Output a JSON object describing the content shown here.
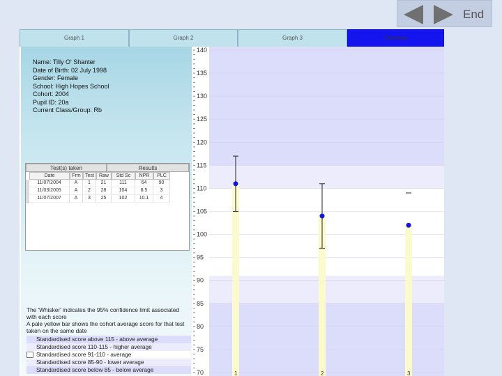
{
  "nav": {
    "back_icon": "left-arrow-icon",
    "forward_icon": "right-arrow-icon",
    "end_label": "End",
    "panel_color": "#c3cee2"
  },
  "tabs": [
    {
      "label": "Graph 1"
    },
    {
      "label": "Graph 2"
    },
    {
      "label": "Graph 3"
    },
    {
      "label": "Overview"
    }
  ],
  "pupil": {
    "name": "Name: Tilly O' Shanter",
    "dob": "Date of Birth: 02 July 1998",
    "gender": "Gender: Female",
    "school": "School: High Hopes School",
    "cohort": "Cohort: 2004",
    "pupil_id": "Pupil ID: 20a",
    "current_class": "Current Class/Group: Rb"
  },
  "tests_table": {
    "group_headers": [
      "Test(s) taken",
      "Results"
    ],
    "columns": [
      "Date",
      "Frm",
      "Test",
      "Raw",
      "Std Sc",
      "NPR",
      "PLC"
    ],
    "rows": [
      [
        "11/07/2004",
        "A",
        "1",
        "21",
        "111",
        "64",
        "90"
      ],
      [
        "11/03/2005",
        "A",
        "2",
        "28",
        "104",
        "8.5",
        "3"
      ],
      [
        "11/07/2007",
        "A",
        "3",
        "25",
        "102",
        "10.1",
        "4"
      ]
    ]
  },
  "legend": {
    "whisker_text": "The 'Whisker' indicates the 95% confidence limit associated with each score",
    "cohort_text": "A pale yellow bar shows the cohort average score for that test taken on the same date",
    "bands": [
      {
        "label": "Standardised score above 115 - above average",
        "color": "#dcdcfb"
      },
      {
        "label": "Standardised score 110-115 - higher average",
        "color": "#ececfc"
      },
      {
        "label": "Standardised score 91-110 - average",
        "color": "#ffffff"
      },
      {
        "label": "Standardised score 85-90 - lower average",
        "color": "#ececfc"
      },
      {
        "label": "Standardised score below 85 - below average",
        "color": "#dcdcfb"
      }
    ]
  },
  "chart_data": {
    "type": "scatter",
    "categories": [
      "1",
      "2",
      "3"
    ],
    "ylim": [
      70,
      140
    ],
    "y_ticks": [
      "140",
      "135",
      "130",
      "125",
      "120",
      "115",
      "110",
      "105",
      "100",
      "95",
      "90",
      "85",
      "80",
      "75",
      "70"
    ],
    "series": [
      {
        "values": [
          111,
          104,
          102
        ],
        "lower": [
          105,
          97,
          null
        ],
        "upper": [
          117,
          111,
          109
        ]
      }
    ],
    "point_color": "#1414e0",
    "bands": [
      {
        "from": 115,
        "to": 140,
        "color": "#dcdcfb"
      },
      {
        "from": 110,
        "to": 115,
        "color": "#ececfc"
      },
      {
        "from": 91,
        "to": 110,
        "color": "#ffffff"
      },
      {
        "from": 85,
        "to": 91,
        "color": "#ececfc"
      },
      {
        "from": 70,
        "to": 85,
        "color": "#dcdcfb"
      }
    ],
    "cohort_bar_color": "#fafacc"
  }
}
